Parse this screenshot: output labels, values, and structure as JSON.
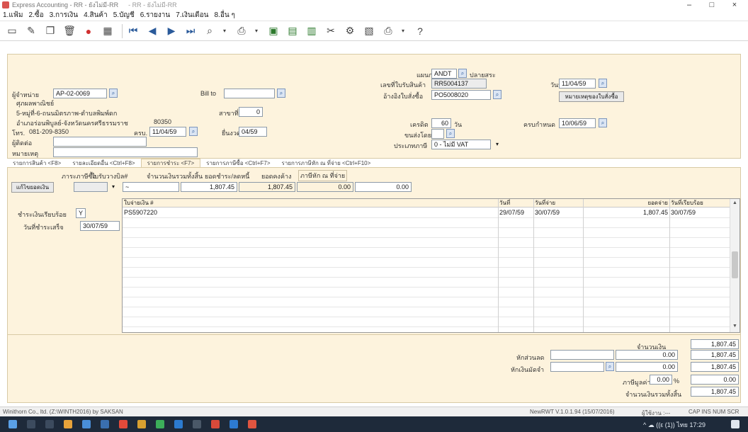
{
  "window": {
    "title": "Express Accounting - RR - ยังไม่มี-RR",
    "subtitle": "- RR - ยังไม่มี-RR",
    "controls": [
      "–",
      "□",
      "×"
    ]
  },
  "menu": [
    "1.แฟ้ม",
    "2.ซื้อ",
    "3.การเงิน",
    "4.สินค้า",
    "5.บัญชี",
    "6.รายงาน",
    "7.เงินเดือน",
    "8.อื่น ๆ"
  ],
  "toolbar_icons": [
    "new-doc",
    "edit",
    "copy",
    "delete",
    "stop",
    "calc",
    "first",
    "prev",
    "next",
    "last",
    "preview",
    "print",
    "save",
    "export",
    "calendar",
    "tools",
    "settings",
    "import",
    "printer",
    "help"
  ],
  "header": {
    "supplier_label": "ผู้จำหน่าย",
    "supplier_code": "AP-02-0069",
    "supplier_name": "ศุภผลพาณิชย์",
    "address1": "5-หมู่ที่-6-ถนนมิตรภาพ-ตำบลพิมพ์ดก",
    "address2": "อำเภอร่อนพิบูลย์-จังหวัดนครศรีธรรมราช",
    "postcode": "80350",
    "phone_label": "โทร.",
    "phone": "081-209-8350",
    "contact_label": "ผู้ติดต่อ",
    "contact_value": "",
    "note_label": "หมายเหตุ",
    "note_value": "",
    "bill_label": "Bill to",
    "bill_value": "",
    "branch_label": "สาขาที่",
    "branch_value": "0",
    "due_label": "ครบ.",
    "due_date": "11/04/59",
    "period_label": "ยื่นงวด",
    "period_value": "04/59",
    "dept_label": "แผนก",
    "dept_code": "ANDT",
    "dept_name": "ปลายสระ",
    "receipt_label": "เลขที่ใบรับสินค้า",
    "receipt_no": "RR5004137",
    "po_label": "อ้างอิงใบสั่งซื้อ",
    "po_no": "PO5008020",
    "credit_label": "เครดิต",
    "credit_days": "60",
    "credit_unit": "วัน",
    "ship_label": "ขนส่งโดย",
    "ship_value": "",
    "tax_type_label": "ประเภทภาษี",
    "tax_type_value": "0 - ไม่มี VAT",
    "date_label": "วันที่",
    "doc_date": "11/04/59",
    "po_ref_button": "หมายเหตุของใบสั่งซื้อ",
    "due_pay_label": "ครบกำหนด",
    "due_pay_date": "10/06/59"
  },
  "tabs": [
    "รายการสินค้า <F8>",
    "รายละเอียดอื่น <Ctrl+F8>",
    "รายการชำระ <F7>",
    "รายการภาษีซื้อ <Ctrl+F7>",
    "รายการภาษีหัก ณ ที่จ่าย <Ctrl+F10>"
  ],
  "payment_summary": {
    "col_headers": [
      "ภาระภาษีซื้อ",
      "ใบรับวางบิล#",
      "จำนวนเงินรวมทั้งสิ้น",
      "ยอดชำระ/ลดหนี้",
      "ยอดคงค้าง",
      "ภาษีหัก ณ ที่จ่าย"
    ],
    "pay_button": "แก้ไขยอดเงิน",
    "pay_select": "",
    "bill_no": "~",
    "total": "1,807.45",
    "paid": "1,807.45",
    "balance": "0.00",
    "withholding": "0.00"
  },
  "paid_flag_label": "ชำระเงินเรียบร้อย",
  "paid_flag_value": "Y",
  "paid_date_label": "วันที่ชำระเสร็จ",
  "paid_date_value": "30/07/59",
  "grid": {
    "headers": [
      "ใบจ่ายเงิน #",
      "วันที่",
      "วันที่จ่าย",
      "ยอดจ่าย",
      "วันที่เรียบร้อย"
    ],
    "rows": [
      {
        "doc": "PS5907220",
        "date": "29/07/59",
        "pay_date": "30/07/59",
        "amount": "1,807.45",
        "done_date": "30/07/59"
      }
    ]
  },
  "totals": {
    "amount_label": "จำนวนเงิน",
    "amount_value": "1,807.45",
    "discount_label": "หักส่วนลด",
    "discount_input": "",
    "discount_amt": "0.00",
    "discount_total": "1,807.45",
    "deposit_label": "หักเงินมัดจำ",
    "deposit_input": "",
    "deposit_amt": "0.00",
    "deposit_total": "1,807.45",
    "vat_label": "ภาษีมูลค่าเพิ่ม",
    "vat_rate": "0.00",
    "vat_unit": "%",
    "vat_value": "0.00",
    "grand_label": "จำนวนเงินรวมทั้งสิ้น",
    "grand_value": "1,807.45"
  },
  "status": {
    "left": "Winithorn Co., ltd. (Z:\\WINTH2016) by SAKSAN",
    "version": "NewRWT V.1.0.1.94 (15/07/2016)",
    "user": "ผู้ใช้งาน :---",
    "keys": "CAP  INS  NUM  SCR"
  },
  "taskbar": {
    "tray": "^ ☁ ((ε (1)) ไทย  17:29"
  }
}
